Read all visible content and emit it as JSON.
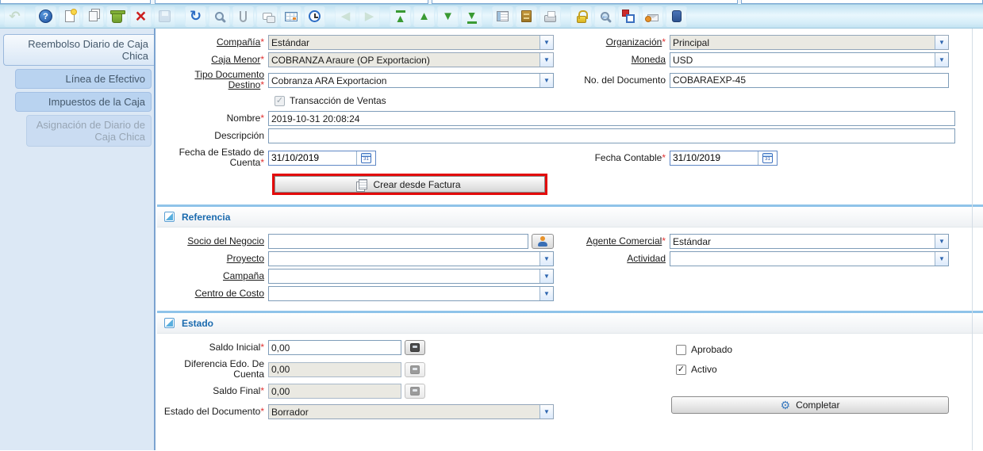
{
  "ui": {
    "required_mark": "*",
    "combo_arrow": "▼"
  },
  "colors": {
    "accent_blue": "#1a6aae",
    "section_divider": "#8fc3e9",
    "highlight_red": "#e30b0b",
    "sidebar_bg": "#dce8f5",
    "readonly_bg": "#eae9e2",
    "toolbar_bg": "#d5edf8"
  },
  "toolbar": {
    "icon_names": [
      "undo-icon",
      "help-icon",
      "new-record-icon",
      "copy-record-icon",
      "delete-record-icon",
      "delete-selection-icon",
      "save-icon",
      "refresh-icon",
      "find-icon",
      "attachment-icon",
      "chat-icon",
      "grid-toggle-icon",
      "history-icon",
      "parent-record-icon",
      "detail-record-icon",
      "first-record-icon",
      "previous-record-icon",
      "next-record-icon",
      "last-record-icon",
      "report-icon",
      "archive-icon",
      "print-icon",
      "lock-icon",
      "zoom-across-icon",
      "workflow-icon",
      "request-icon",
      "product-info-icon"
    ]
  },
  "sidebar": {
    "tabs": [
      {
        "label": "Reembolso Diario de Caja Chica",
        "active": true
      },
      {
        "label": "Línea de Efectivo"
      },
      {
        "label": "Impuestos de la Caja"
      },
      {
        "label": "Asignación de Diario de Caja Chica",
        "disabled": true
      }
    ]
  },
  "form": {
    "compania": {
      "label": "Compañía",
      "value": "Estándar",
      "required": true,
      "readonly": true
    },
    "organizacion": {
      "label": "Organización",
      "value": "Principal",
      "required": true,
      "readonly": true
    },
    "caja_menor": {
      "label": "Caja Menor",
      "value": "COBRANZA Araure (OP Exportacion)",
      "required": true,
      "readonly": true
    },
    "moneda": {
      "label": "Moneda",
      "value": "USD"
    },
    "tipo_doc": {
      "label": "Tipo Documento Destino",
      "value": "Cobranza ARA Exportacion",
      "required": true
    },
    "no_doc": {
      "label": "No. del Documento",
      "value": "COBARAEXP-45"
    },
    "trans_ventas": {
      "label": "Transacción de Ventas",
      "checked": true,
      "disabled": true
    },
    "nombre": {
      "label": "Nombre",
      "value": "2019-10-31 20:08:24",
      "required": true
    },
    "descripcion": {
      "label": "Descripción",
      "value": ""
    },
    "fecha_edo": {
      "label": "Fecha de Estado de Cuenta",
      "value": "31/10/2019",
      "required": true
    },
    "fecha_contable": {
      "label": "Fecha Contable",
      "value": "31/10/2019",
      "required": true
    },
    "crear_btn": "Crear desde Factura"
  },
  "referencia": {
    "title": "Referencia",
    "socio": {
      "label": "Socio del Negocio",
      "value": ""
    },
    "agente": {
      "label": "Agente Comercial",
      "value": "Estándar",
      "required": true
    },
    "proyecto": {
      "label": "Proyecto",
      "value": ""
    },
    "actividad": {
      "label": "Actividad",
      "value": ""
    },
    "campana": {
      "label": "Campaña",
      "value": ""
    },
    "centro_costo": {
      "label": "Centro de Costo",
      "value": ""
    }
  },
  "estado": {
    "title": "Estado",
    "saldo_inicial": {
      "label": "Saldo Inicial",
      "value": "0,00",
      "required": true
    },
    "dif_cuenta": {
      "label": "Diferencia Edo. De Cuenta",
      "value": "0,00",
      "readonly": true
    },
    "saldo_final": {
      "label": "Saldo Final",
      "value": "0,00",
      "required": true,
      "readonly": true
    },
    "estado_doc": {
      "label": "Estado del Documento",
      "value": "Borrador",
      "required": true,
      "readonly": true
    },
    "aprobado": {
      "label": "Aprobado",
      "checked": false
    },
    "activo": {
      "label": "Activo",
      "checked": true
    },
    "completar_btn": "Completar"
  }
}
